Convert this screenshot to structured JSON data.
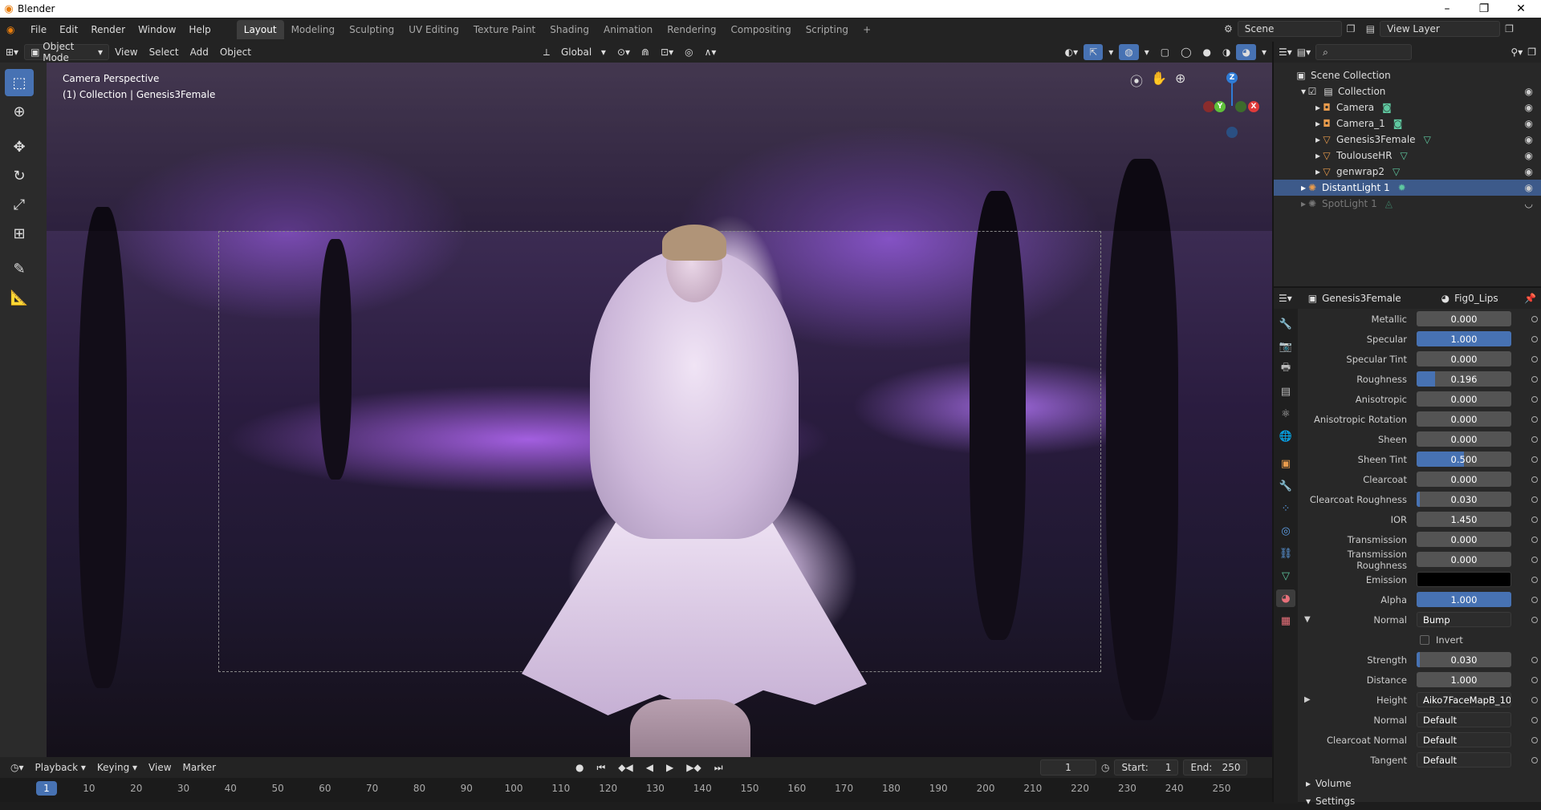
{
  "window": {
    "title": "Blender",
    "minimize": "–",
    "maximize": "❐",
    "close": "✕"
  },
  "menus": [
    "File",
    "Edit",
    "Render",
    "Window",
    "Help"
  ],
  "workspaces": [
    "Layout",
    "Modeling",
    "Sculpting",
    "UV Editing",
    "Texture Paint",
    "Shading",
    "Animation",
    "Rendering",
    "Compositing",
    "Scripting"
  ],
  "workspace_add": "+",
  "scene": {
    "name": "Scene",
    "view_layer": "View Layer"
  },
  "viewport": {
    "mode": "Object Mode",
    "menus": [
      "View",
      "Select",
      "Add",
      "Object"
    ],
    "orientation": "Global",
    "overlay_line1": "Camera Perspective",
    "overlay_line2": "(1) Collection | Genesis3Female",
    "gizmo": {
      "z": "Z",
      "y": "Y",
      "x": "X"
    }
  },
  "timeline": {
    "menus": [
      "Playback",
      "Keying",
      "View",
      "Marker"
    ],
    "current_frame": "1",
    "start_label": "Start:",
    "start": "1",
    "end_label": "End:",
    "end": "250",
    "ticks": [
      "1",
      "10",
      "20",
      "30",
      "40",
      "50",
      "60",
      "70",
      "80",
      "90",
      "100",
      "110",
      "120",
      "130",
      "140",
      "150",
      "160",
      "170",
      "180",
      "190",
      "200",
      "210",
      "220",
      "230",
      "240",
      "250"
    ]
  },
  "outliner": {
    "root": "Scene Collection",
    "items": [
      {
        "label": "Collection",
        "icon": "collection-icon"
      },
      {
        "label": "Camera",
        "icon": "camera-object-icon"
      },
      {
        "label": "Camera_1",
        "icon": "camera-object-icon"
      },
      {
        "label": "Genesis3Female",
        "icon": "mesh-object-icon"
      },
      {
        "label": "ToulouseHR",
        "icon": "mesh-object-icon"
      },
      {
        "label": "genwrap2",
        "icon": "mesh-object-icon"
      },
      {
        "label": "DistantLight 1",
        "icon": "light-object-icon"
      },
      {
        "label": "SpotLight 1",
        "icon": "light-object-icon"
      }
    ]
  },
  "properties": {
    "object": "Genesis3Female",
    "material": "Fig0_Lips",
    "rows": [
      {
        "label": "Metallic",
        "value": "0.000",
        "fill": 0
      },
      {
        "label": "Specular",
        "value": "1.000",
        "fill": 1
      },
      {
        "label": "Specular Tint",
        "value": "0.000",
        "fill": 0
      },
      {
        "label": "Roughness",
        "value": "0.196",
        "fill": 0.196
      },
      {
        "label": "Anisotropic",
        "value": "0.000",
        "fill": 0
      },
      {
        "label": "Anisotropic Rotation",
        "value": "0.000",
        "fill": 0
      },
      {
        "label": "Sheen",
        "value": "0.000",
        "fill": 0
      },
      {
        "label": "Sheen Tint",
        "value": "0.500",
        "fill": 0.5
      },
      {
        "label": "Clearcoat",
        "value": "0.000",
        "fill": 0
      },
      {
        "label": "Clearcoat Roughness",
        "value": "0.030",
        "fill": 0.03
      },
      {
        "label": "IOR",
        "value": "1.450",
        "fill": 0
      },
      {
        "label": "Transmission",
        "value": "0.000",
        "fill": 0
      },
      {
        "label": "Transmission Roughness",
        "value": "0.000",
        "fill": 0
      }
    ],
    "emission_label": "Emission",
    "emission_color": "#000000",
    "alpha": {
      "label": "Alpha",
      "value": "1.000",
      "fill": 1
    },
    "normal": {
      "label": "Normal",
      "value": "Bump"
    },
    "invert_label": "Invert",
    "bump_rows": [
      {
        "label": "Strength",
        "value": "0.030",
        "fill": 0.03
      },
      {
        "label": "Distance",
        "value": "1.000",
        "fill": 0
      }
    ],
    "height": {
      "label": "Height",
      "value": "Aiko7FaceMapB_10..."
    },
    "normal2": {
      "label": "Normal",
      "value": "Default"
    },
    "clearcoat_normal": {
      "label": "Clearcoat Normal",
      "value": "Default"
    },
    "tangent": {
      "label": "Tangent",
      "value": "Default"
    },
    "sections": [
      "Volume",
      "Settings"
    ]
  },
  "colors": {
    "accent": "#4772b3",
    "selected_row": "#3d5a8a"
  }
}
